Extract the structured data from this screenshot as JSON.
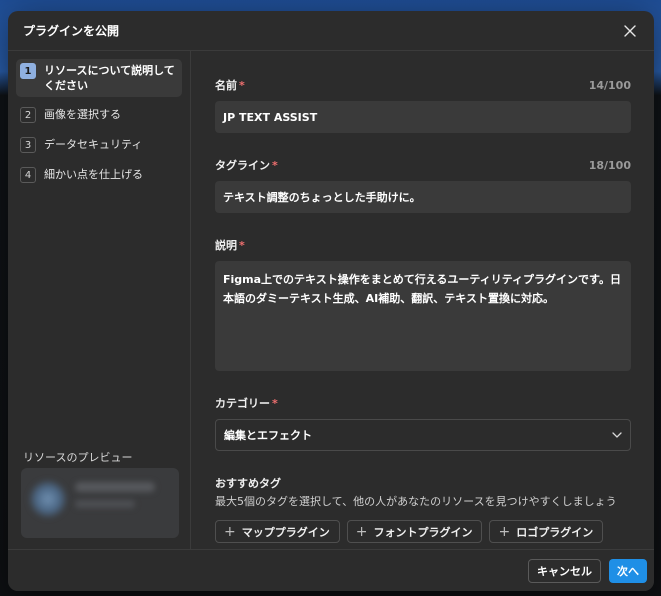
{
  "dialog": {
    "title": "プラグインを公開"
  },
  "steps": [
    {
      "num": "1",
      "label": "リソースについて説明してください"
    },
    {
      "num": "2",
      "label": "画像を選択する"
    },
    {
      "num": "3",
      "label": "データセキュリティ"
    },
    {
      "num": "4",
      "label": "細かい点を仕上げる"
    }
  ],
  "preview": {
    "label": "リソースのプレビュー"
  },
  "fields": {
    "name": {
      "label": "名前",
      "required": "*",
      "counter": "14/100",
      "value": "JP TEXT ASSIST"
    },
    "tagline": {
      "label": "タグライン",
      "required": "*",
      "counter": "18/100",
      "value": "テキスト調整のちょっとした手助けに。"
    },
    "description": {
      "label": "説明",
      "required": "*",
      "value": "Figma上でのテキスト操作をまとめて行えるユーティリティプラグインです。日本語のダミーテキスト生成、AI補助、翻訳、テキスト置換に対応。"
    },
    "category": {
      "label": "カテゴリー",
      "required": "*",
      "value": "編集とエフェクト"
    }
  },
  "recommended_tags": {
    "label": "おすすめタグ",
    "hint": "最大5個のタグを選択して、他の人があなたのリソースを見つけやすくしましょう",
    "items": [
      "マッププラグイン",
      "フォントプラグイン",
      "ロゴプラグイン"
    ]
  },
  "footer": {
    "cancel": "キャンセル",
    "next": "次へ"
  },
  "colors": {
    "accent": "#1f8fe6",
    "required": "#ef6f6f",
    "active_step": "#8fb0e0"
  },
  "icons": {
    "close": "close-icon",
    "chevron": "chevron-down-icon",
    "plus": "plus-icon"
  }
}
